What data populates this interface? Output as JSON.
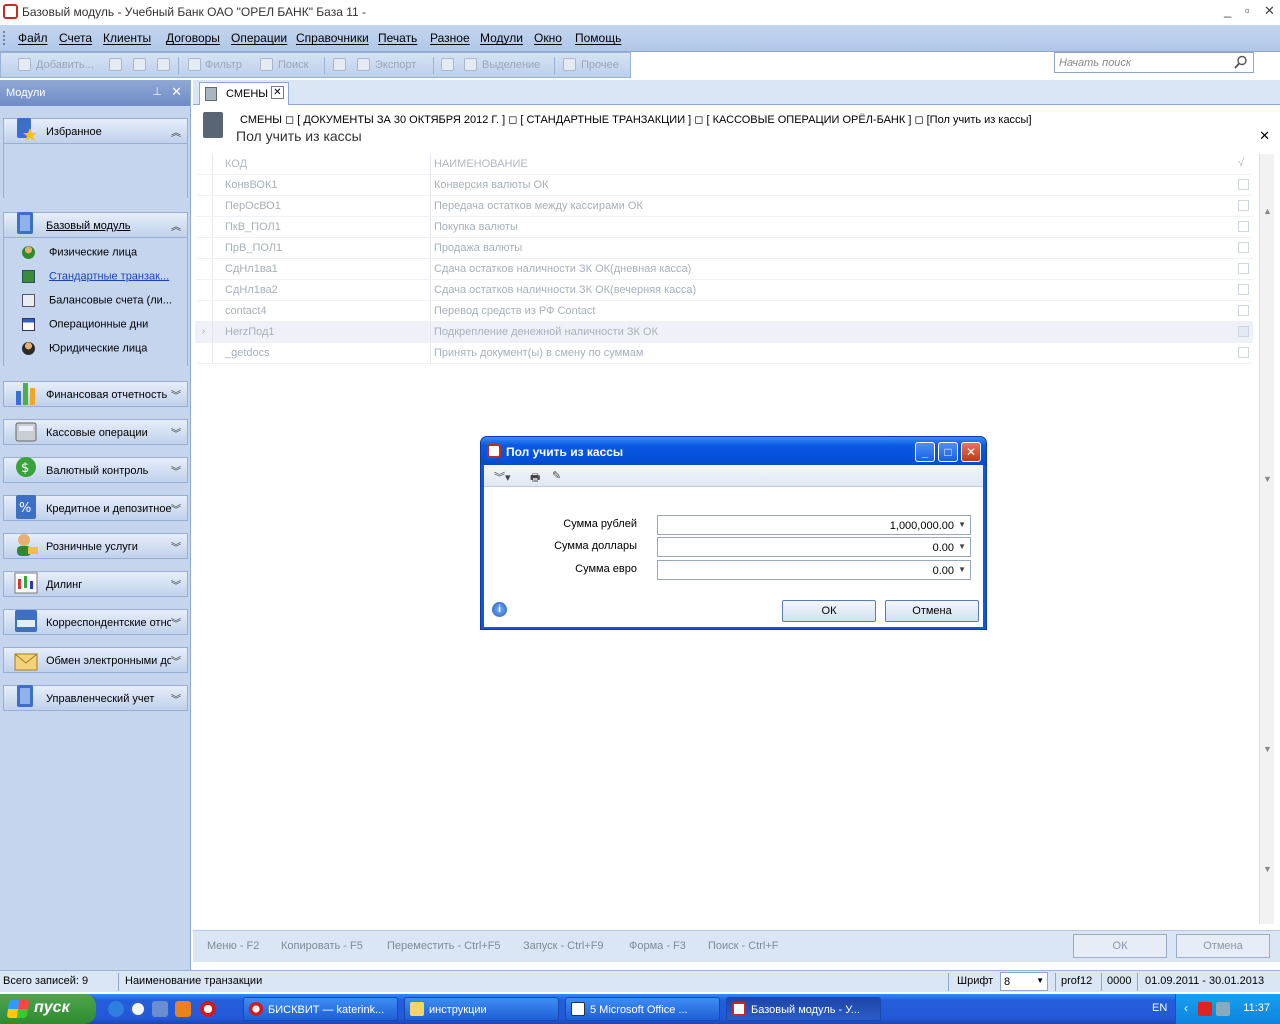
{
  "window": {
    "title": "Базовый модуль - Учебный Банк ОАО \"ОРЕЛ БАНК\" База 11 -",
    "min": "_",
    "max": "▫",
    "close": "✕"
  },
  "menu": [
    "Файл",
    "Счета",
    "Клиенты",
    "Договоры",
    "Операции",
    "Справочники",
    "Печать",
    "Разное",
    "Модули",
    "Окно",
    "Помощь"
  ],
  "search": {
    "placeholder": "Начать поиск"
  },
  "toolbar": {
    "add": "Добавить...",
    "filter": "Фильтр",
    "search": "Поиск",
    "export": "Экспорт",
    "select": "Выделение",
    "other": "Прочее"
  },
  "sidebar": {
    "title": "Модули",
    "favorites": "Избранное",
    "base_module": "Базовый модуль",
    "base_items": [
      "Физические лица",
      "Стандартные транзак...",
      "Балансовые счета (ли...",
      "Операционные дни",
      "Юридические лица"
    ],
    "groups": [
      "Финансовая отчетность",
      "Кассовые операции",
      "Валютный контроль",
      "Кредитное и депозитное",
      "Розничные услуги",
      "Дилинг",
      "Корреспондентские отношения",
      "Обмен электронными документами",
      "Управленческий учет"
    ]
  },
  "tab": {
    "label": "СМЕНЫ"
  },
  "breadcrumb": {
    "path": "СМЕНЫ  ◻ [ ДОКУМЕНТЫ ЗА 30 ОКТЯБРЯ 2012 Г.  ] ◻ [ СТАНДАРТНЫЕ ТРАНЗАКЦИИ ] ◻ [ КАССОВЫЕ ОПЕРАЦИИ ОРЁЛ-БАНК ] ◻ [Пол учить из кассы]",
    "subtitle": "Пол учить из кассы"
  },
  "grid": {
    "headers": {
      "code": "КОД",
      "name": "НАИМЕНОВАНИЕ",
      "check": "√"
    },
    "rows": [
      {
        "code": "КонвВОК1",
        "name": "Конверсия валюты ОК"
      },
      {
        "code": "ПерОсВО1",
        "name": "Передача остатков между кассирами ОК"
      },
      {
        "code": "ПкВ_ПОЛ1",
        "name": "Покупка валюты"
      },
      {
        "code": "ПрВ_ПОЛ1",
        "name": "Продажа валюты"
      },
      {
        "code": "СдНл1ва1",
        "name": "Сдача остатков наличности ЗК ОК(дневная касса)"
      },
      {
        "code": "СдНл1ва2",
        "name": "Сдача остатков наличности ЗК ОК(вечерняя касса)"
      },
      {
        "code": "contact4",
        "name": "Перевод средств из РФ Contact"
      },
      {
        "code": "HerzПод1",
        "name": "Подкрепление денежной наличности ЗК ОК"
      },
      {
        "code": "_getdocs",
        "name": "Принять документ(ы) в смену по суммам"
      }
    ]
  },
  "bottom": {
    "keys": [
      "Меню - F2",
      "Копировать - F5",
      "Переместить - Ctrl+F5",
      "Запуск - Ctrl+F9",
      "Форма - F3",
      "Поиск - Ctrl+F"
    ],
    "ok": "ОК",
    "cancel": "Отмена"
  },
  "status": {
    "records": "Всего записей: 9",
    "field": "Наименование транзакции",
    "font_label": "Шрифт",
    "font_size": "8",
    "user": "prof12",
    "code": "0000",
    "period": "01.09.2011 - 30.01.2013"
  },
  "dialog": {
    "title": "Пол учить из кассы",
    "fields": [
      {
        "label": "Сумма рублей",
        "value": "1,000,000.00"
      },
      {
        "label": "Сумма доллары",
        "value": "0.00"
      },
      {
        "label": "Сумма евро",
        "value": "0.00"
      }
    ],
    "ok": "ОК",
    "cancel": "Отмена",
    "info": "i"
  },
  "taskbar": {
    "start": "пуск",
    "tasks": [
      "БИСКВИТ — katerink...",
      "инструкции",
      "5 Microsoft Office ...",
      "Базовый модуль - У..."
    ],
    "lang": "EN",
    "clock": "11:37"
  }
}
